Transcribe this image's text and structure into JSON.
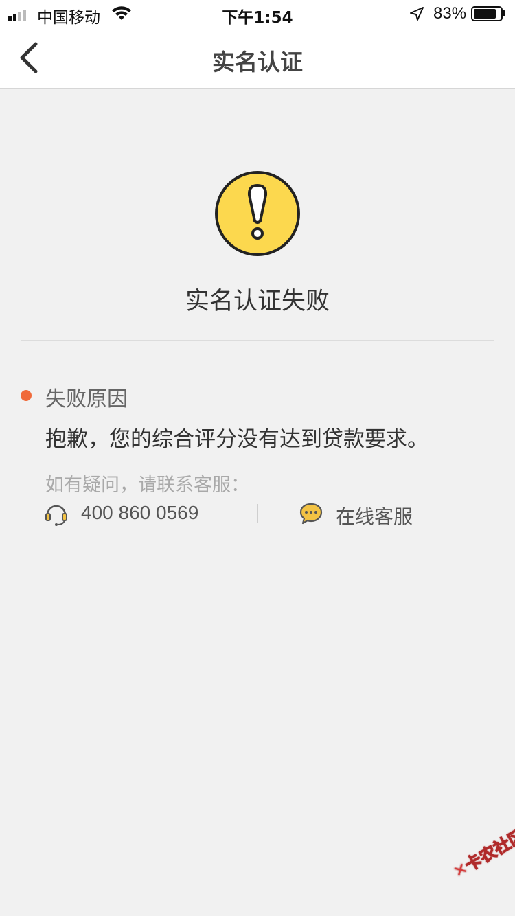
{
  "status_bar": {
    "carrier": "中国移动",
    "time": "下午1:54",
    "battery_percent": "83%",
    "battery_level": 0.83,
    "icons": [
      "signal-icon",
      "wifi-icon",
      "location-arrow-icon",
      "battery-icon"
    ]
  },
  "nav": {
    "title": "实名认证",
    "back_icon": "chevron-left-icon"
  },
  "result": {
    "icon": "warning-exclamation-icon",
    "icon_color": "#fcd84e",
    "title": "实名认证失败"
  },
  "reason": {
    "label": "失败原因",
    "text": "抱歉，您的综合评分没有达到贷款要求。",
    "dot_color": "#f06a3a"
  },
  "contact": {
    "prompt": "如有疑问，请联系客服：",
    "phone_icon": "headset-icon",
    "phone": "400 860 0569",
    "chat_icon": "chat-bubble-icon",
    "online_service": "在线客服"
  },
  "watermark": {
    "text": "卡农社区",
    "logo": "✕"
  }
}
